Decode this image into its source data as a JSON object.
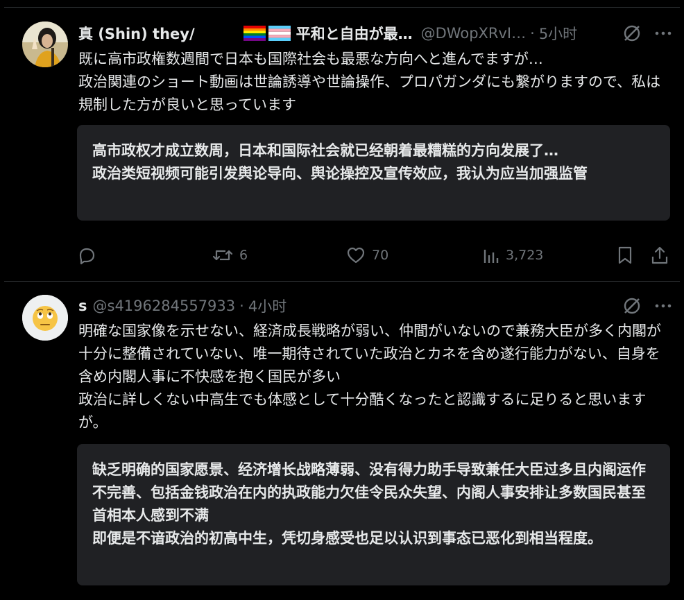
{
  "colors": {
    "background": "#000000",
    "text": "#e7e9ea",
    "muted": "#71767b",
    "divider": "#2f3336",
    "translation_bg": "#202124"
  },
  "posts": [
    {
      "name": "真 (Shin) they/",
      "name_suffix": "平和と自由が最…",
      "handle": "@DWopXRvI…",
      "dot": "·",
      "time": "5小时",
      "text": "既に高市政権数週間で日本も国際社会も最悪な方向へと進んでますが…\n政治関連のショート動画は世論誘導や世論操作、プロパガンダにも繋がりますので、私は規制した方が良いと思っています",
      "translation": "高市政权才成立数周，日本和国际社会就已经朝着最糟糕的方向发展了…\n政治类短视频可能引发舆论导向、舆论操控及宣传效应，我认为应当加强监管",
      "stats": {
        "reposts": "6",
        "likes": "70",
        "views": "3,723"
      }
    },
    {
      "name": "s",
      "handle": "@s4196284557933",
      "dot": "·",
      "time": "4小时",
      "text": "明確な国家像を示せない、経済成長戦略が弱い、仲間がいないので兼務大臣が多く内閣が十分に整備されていない、唯一期待されていた政治とカネを含め遂行能力がない、自身を含め内閣人事に不快感を抱く国民が多い\n政治に詳しくない中高生でも体感として十分酷くなったと認識するに足りると思いますが。",
      "translation": "缺乏明确的国家愿景、经济增长战略薄弱、没有得力助手导致兼任大臣过多且内阁运作不完善、包括金钱政治在内的执政能力欠佳令民众失望、内阁人事安排让多数国民甚至首相本人感到不满\n即便是不谙政治的初高中生，凭切身感受也足以认识到事态已恶化到相当程度。"
    }
  ]
}
